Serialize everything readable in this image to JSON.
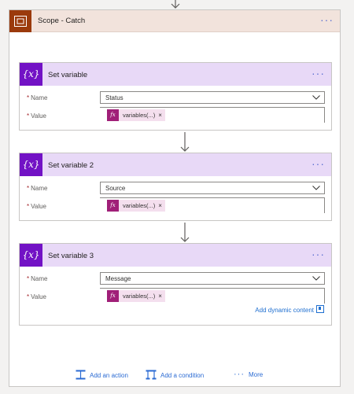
{
  "scope": {
    "title": "Scope - Catch",
    "menu_icon": "ellipsis-icon",
    "icon": "scope-icon"
  },
  "cards": [
    {
      "title": "Set variable",
      "name_label": "Name",
      "name_value": "Status",
      "value_label": "Value",
      "token_text": "variables(...)",
      "token_icon_text": "fx",
      "token_close": "×",
      "icon_text": "{x}"
    },
    {
      "title": "Set variable 2",
      "name_label": "Name",
      "name_value": "Source",
      "value_label": "Value",
      "token_text": "variables(...)",
      "token_icon_text": "fx",
      "token_close": "×",
      "icon_text": "{x}"
    },
    {
      "title": "Set variable 3",
      "name_label": "Name",
      "name_value": "Message",
      "value_label": "Value",
      "token_text": "variables(...)",
      "token_icon_text": "fx",
      "token_close": "×",
      "icon_text": "{x}"
    }
  ],
  "required_marker": "*",
  "menu_dots": "···",
  "dynamic_content_link": "Add dynamic content",
  "actions": {
    "add_action": "Add an action",
    "add_condition": "Add a condition",
    "more": "More"
  },
  "colors": {
    "scope_header_bg": "#f2e3dc",
    "scope_icon_bg": "#9b3a0c",
    "card_header_bg": "#e8d9f7",
    "variable_icon_bg": "#7212c5",
    "token_bg": "#f4dfee",
    "token_icon_bg": "#a01f78",
    "link_color": "#2b6bd3"
  }
}
